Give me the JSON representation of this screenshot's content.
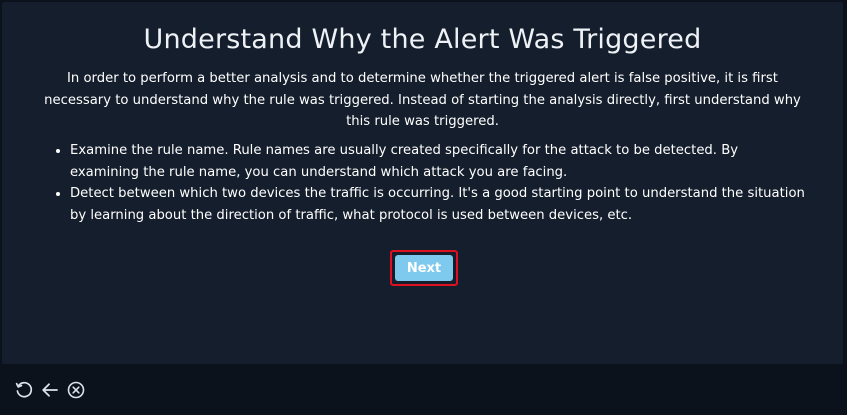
{
  "page": {
    "title": "Understand Why the Alert Was Triggered",
    "intro": "In order to perform a better analysis and to determine whether the triggered alert is false positive, it is first necessary to understand why the rule was triggered. Instead of starting the analysis directly, first understand why this rule was triggered.",
    "bullets": [
      "Examine the rule name. Rule names are usually created specifically for the attack to be detected. By examining the rule name, you can understand which attack you are facing.",
      "Detect between which two devices the traffic is occurring. It's a good starting point to understand the situation by learning about the direction of traffic, what protocol is used between devices, etc."
    ],
    "next_label": "Next"
  },
  "footer": {
    "controls": [
      "restart-icon",
      "back-arrow-icon",
      "close-circle-icon"
    ]
  },
  "colors": {
    "panel_bg": "#151e2c",
    "page_bg": "#0c121b",
    "button_bg": "#7ec9ee",
    "highlight_border": "#e0101e",
    "text": "#ffffff"
  }
}
